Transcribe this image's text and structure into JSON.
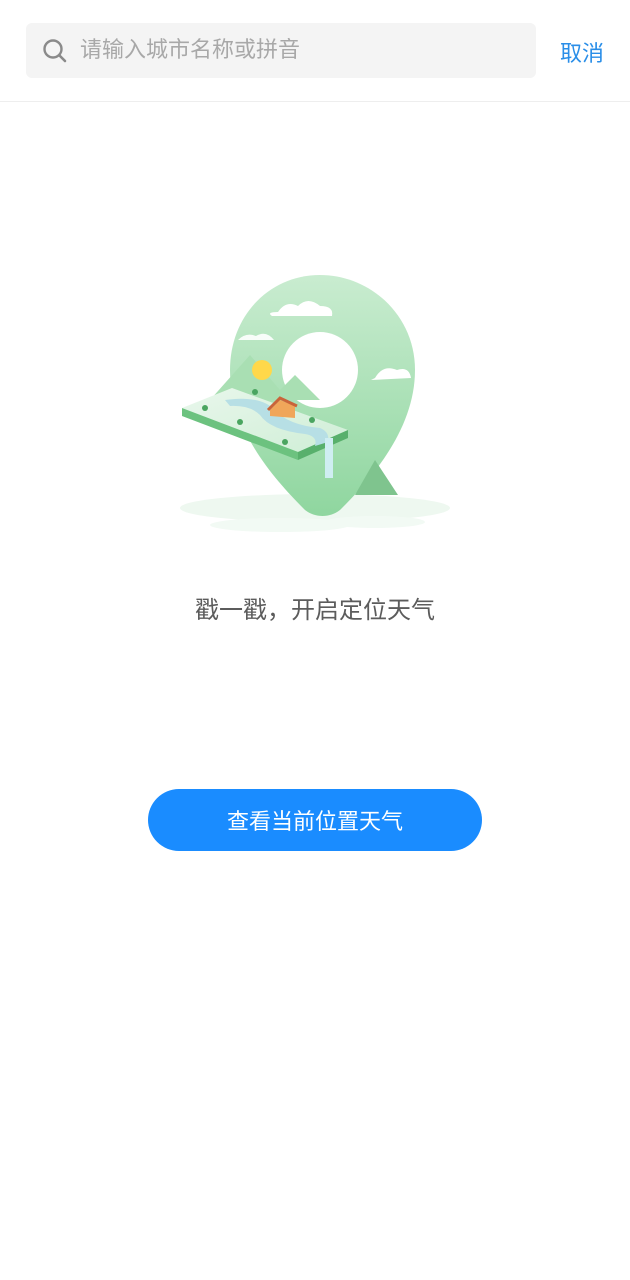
{
  "search": {
    "placeholder": "请输入城市名称或拼音",
    "value": "",
    "cancel_label": "取消"
  },
  "empty_state": {
    "illustration": "location-weather-illustration",
    "hint": "戳一戳，开启定位天气"
  },
  "actions": {
    "locate_label": "查看当前位置天气"
  },
  "colors": {
    "accent": "#1a8cff",
    "cancel": "#2a8ee8",
    "illustration_green": "#9fdcaa"
  }
}
